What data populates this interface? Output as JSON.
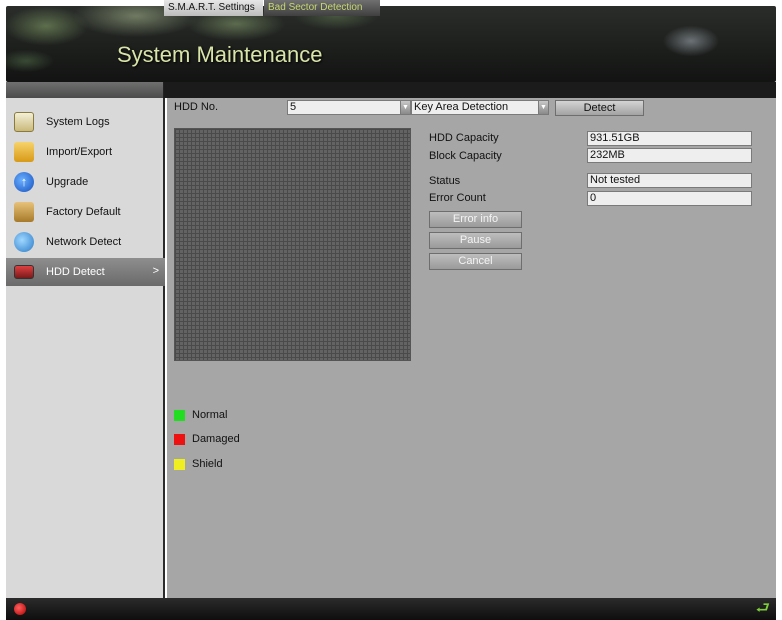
{
  "header": {
    "title": "System Maintenance"
  },
  "tabs": [
    {
      "label": "S.M.A.R.T. Settings",
      "active": true
    },
    {
      "label": "Bad Sector Detection",
      "active": false
    }
  ],
  "sidebar": {
    "items": [
      {
        "label": "System Logs",
        "icon": "system-logs-icon"
      },
      {
        "label": "Import/Export",
        "icon": "folder-icon"
      },
      {
        "label": "Upgrade",
        "icon": "upgrade-arrow-icon"
      },
      {
        "label": "Factory Default",
        "icon": "box-icon"
      },
      {
        "label": "Network Detect",
        "icon": "globe-icon"
      },
      {
        "label": "HDD Detect",
        "icon": "hdd-icon",
        "active": true,
        "arrow": ">"
      }
    ]
  },
  "main": {
    "hdd_label": "HDD No.",
    "hdd_value": "5",
    "mode_value": "Key Area Detection",
    "detect_button": "Detect",
    "info": {
      "hdd_capacity_label": "HDD Capacity",
      "hdd_capacity_value": "931.51GB",
      "block_capacity_label": "Block Capacity",
      "block_capacity_value": "232MB",
      "status_label": "Status",
      "status_value": "Not tested",
      "error_count_label": "Error Count",
      "error_count_value": "0"
    },
    "buttons": {
      "error_info": "Error info",
      "pause": "Pause",
      "cancel": "Cancel"
    },
    "legend": [
      {
        "label": "Normal",
        "color": "#22dd22"
      },
      {
        "label": "Damaged",
        "color": "#ee1111"
      },
      {
        "label": "Shield",
        "color": "#eeee22"
      }
    ]
  },
  "colors": {
    "accent_title": "#d8e4a8",
    "panel_bg": "#a6a6a6",
    "sidebar_bg": "#d9d9d9"
  }
}
